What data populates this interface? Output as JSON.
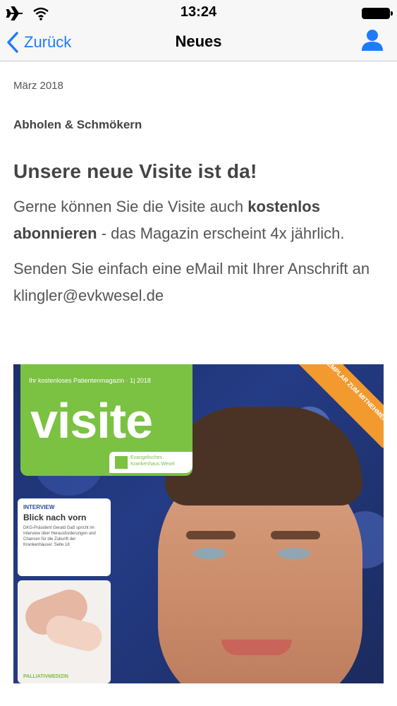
{
  "status_bar": {
    "time": "13:24"
  },
  "nav": {
    "back_label": "Zurück",
    "title": "Neues"
  },
  "article": {
    "date": "März 2018",
    "section": "Abholen & Schmökern",
    "headline": "Unsere neue Visite ist da!",
    "para1_pre": "Gerne können Sie die Visite auch ",
    "para1_bold": "kostenlos abonnieren",
    "para1_post": " - das Magazin erscheint 4x jährlich.",
    "para2": "Senden Sie einfach eine eMail mit Ihrer Anschrift an klingler@evkwesel.de"
  },
  "cover": {
    "tagline": "Ihr kostenloses Patientenmagazin · 1| 2018",
    "logo_word": "visite",
    "hospital": "Evangelisches Krankenhaus Wesel",
    "ribbon": "IHR EXEMPLAR ZUM MITNEHMEN!",
    "card_kicker": "INTERVIEW",
    "card_title": "Blick nach vorn",
    "card_text": "DKG-Präsident Gerald Gaß spricht im Interview über Herausforderungen und Chancen für die Zukunft der Krankenhäuser.   Seite 18",
    "photo_label": "PALLIATIVMEDIZIN"
  },
  "colors": {
    "accent": "#1d7bff",
    "visite_green": "#7bc142",
    "ribbon_orange": "#f29a2e"
  }
}
